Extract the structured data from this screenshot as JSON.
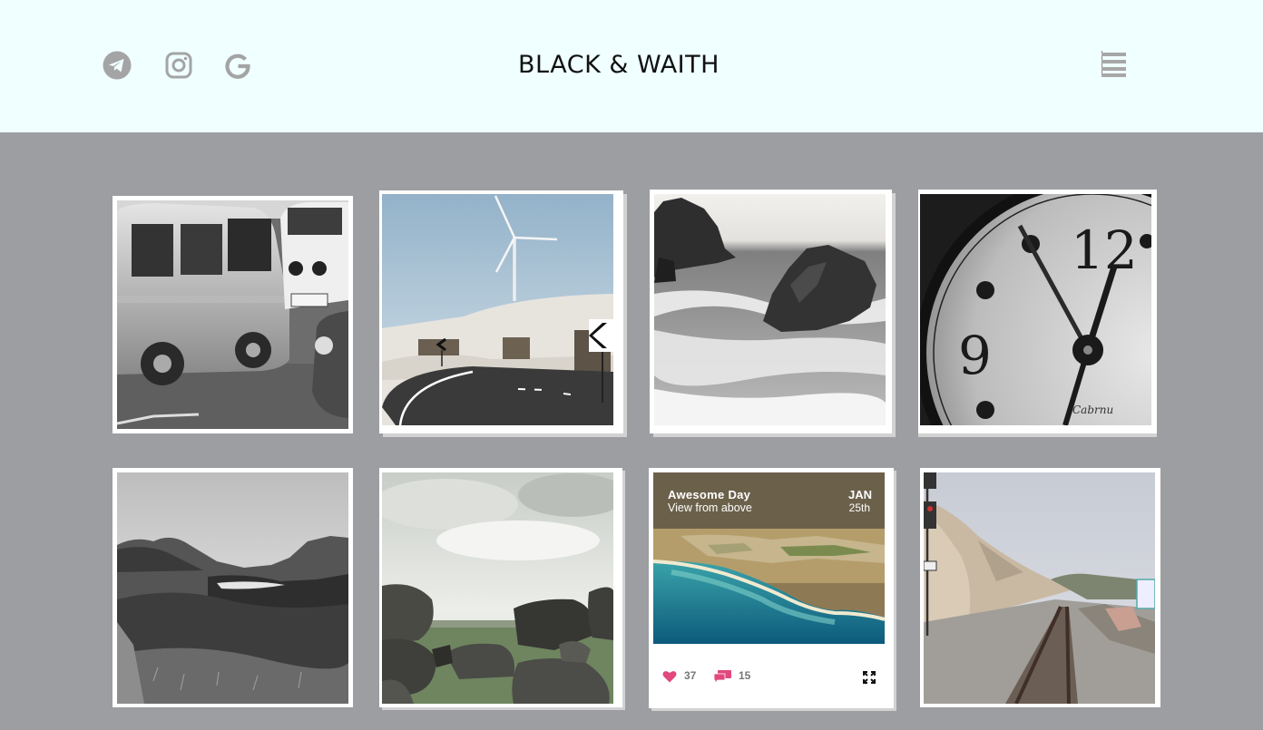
{
  "header": {
    "title": "BLACK & WAITH",
    "social": [
      "telegram-icon",
      "instagram-icon",
      "google-icon"
    ],
    "menu_icon": "hamburger-menu-icon"
  },
  "gallery": {
    "photos": [
      "vintage-van-photo",
      "wind-turbine-road-photo",
      "sea-rocks-photo",
      "clock-face-photo",
      "mountain-valley-photo",
      "boulders-field-photo",
      "railway-track-photo"
    ],
    "featured_card": {
      "title": "Awesome Day",
      "subtitle": "View from above",
      "month": "JAN",
      "day": "25th",
      "likes": "37",
      "comments": "15"
    }
  },
  "colors": {
    "header_bg": "#f0ffff",
    "page_bg": "#9d9ea2",
    "accent_pink": "#e0487e"
  }
}
